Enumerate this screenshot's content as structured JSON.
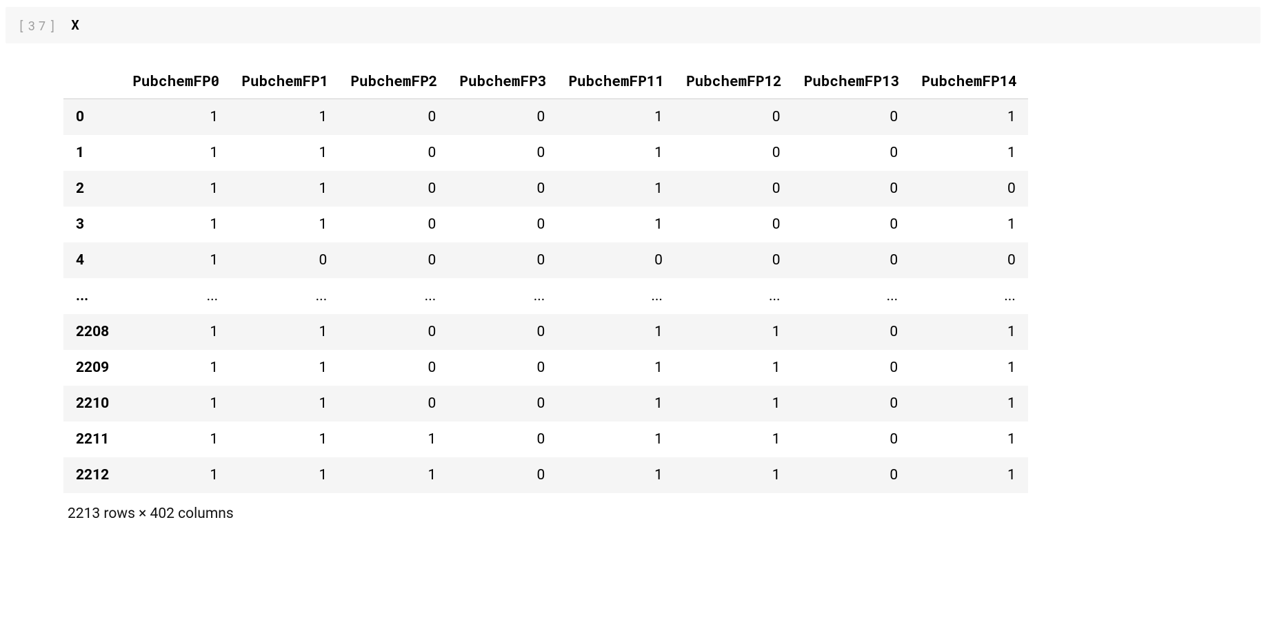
{
  "cell": {
    "exec_label": "[37]",
    "code": "X"
  },
  "table": {
    "columns": [
      "PubchemFP0",
      "PubchemFP1",
      "PubchemFP2",
      "PubchemFP3",
      "PubchemFP11",
      "PubchemFP12",
      "PubchemFP13",
      "PubchemFP14"
    ],
    "rows": [
      {
        "index": "0",
        "cells": [
          "1",
          "1",
          "0",
          "0",
          "1",
          "0",
          "0",
          "1"
        ]
      },
      {
        "index": "1",
        "cells": [
          "1",
          "1",
          "0",
          "0",
          "1",
          "0",
          "0",
          "1"
        ]
      },
      {
        "index": "2",
        "cells": [
          "1",
          "1",
          "0",
          "0",
          "1",
          "0",
          "0",
          "0"
        ]
      },
      {
        "index": "3",
        "cells": [
          "1",
          "1",
          "0",
          "0",
          "1",
          "0",
          "0",
          "1"
        ]
      },
      {
        "index": "4",
        "cells": [
          "1",
          "0",
          "0",
          "0",
          "0",
          "0",
          "0",
          "0"
        ]
      },
      {
        "index": "...",
        "cells": [
          "...",
          "...",
          "...",
          "...",
          "...",
          "...",
          "...",
          "..."
        ]
      },
      {
        "index": "2208",
        "cells": [
          "1",
          "1",
          "0",
          "0",
          "1",
          "1",
          "0",
          "1"
        ]
      },
      {
        "index": "2209",
        "cells": [
          "1",
          "1",
          "0",
          "0",
          "1",
          "1",
          "0",
          "1"
        ]
      },
      {
        "index": "2210",
        "cells": [
          "1",
          "1",
          "0",
          "0",
          "1",
          "1",
          "0",
          "1"
        ]
      },
      {
        "index": "2211",
        "cells": [
          "1",
          "1",
          "1",
          "0",
          "1",
          "1",
          "0",
          "1"
        ]
      },
      {
        "index": "2212",
        "cells": [
          "1",
          "1",
          "1",
          "0",
          "1",
          "1",
          "0",
          "1"
        ]
      }
    ],
    "shape_summary": "2213 rows × 402 columns"
  }
}
